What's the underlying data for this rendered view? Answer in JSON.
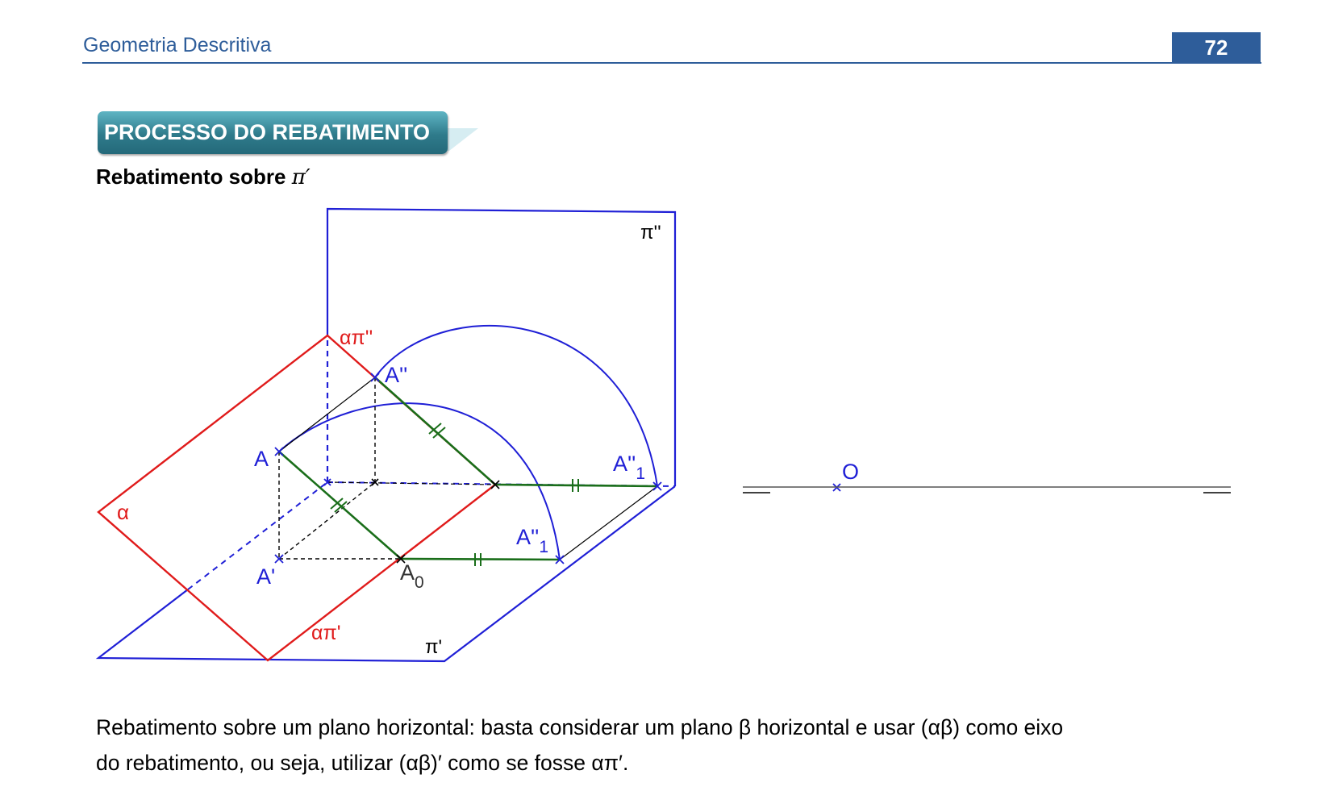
{
  "header": {
    "title": "Geometria Descritiva",
    "page_number": "72"
  },
  "section": {
    "banner": "PROCESSO DO REBATIMENTO",
    "subheading": "Rebatimento sobre ",
    "subheading_symbol": "π′"
  },
  "diagram": {
    "labels": {
      "pi2": "π''",
      "alpha_pi2": "απ''",
      "A2": "A''",
      "A": "A",
      "A2_1_top_main": "A''",
      "A2_1_top_sub": "1",
      "alpha": "α",
      "A2_1_bottom_main": "A''",
      "A2_1_bottom_sub": "1",
      "A1": "A'",
      "A0_main": "A",
      "A0_sub": "0",
      "alpha_pi1": "απ'",
      "pi1": "π'",
      "O": "O"
    }
  },
  "caption": {
    "line1": "Rebatimento sobre um plano horizontal: basta considerar um plano β horizontal e usar (αβ) como eixo",
    "line2": "do rebatimento, ou seja, utilizar (αβ)′ como se fosse απ′."
  },
  "colors": {
    "accent": "#2e5d9a",
    "plane_blue": "#1f1fd6",
    "plane_red": "#e01b1b",
    "segment_green": "#1a6e1a"
  }
}
